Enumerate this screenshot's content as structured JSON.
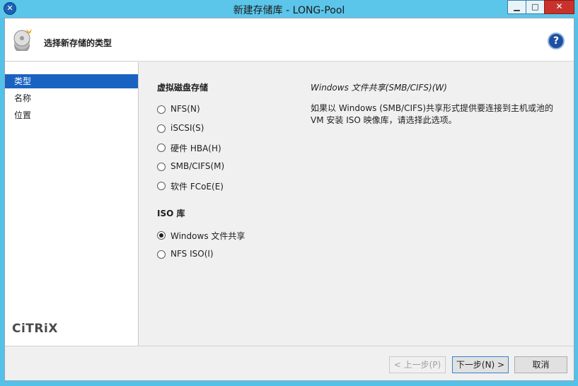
{
  "window": {
    "title": "新建存储库 - LONG-Pool",
    "app_icon": "x-icon",
    "controls": {
      "minimize": "▁",
      "maximize": "□",
      "close": "✕"
    }
  },
  "header": {
    "title": "选择新存储的类型",
    "icon": "disk-icon",
    "help": "?"
  },
  "sidebar": {
    "items": [
      {
        "label": "类型",
        "active": true
      },
      {
        "label": "名称",
        "active": false
      },
      {
        "label": "位置",
        "active": false
      }
    ],
    "logo": "CiTRiX"
  },
  "main": {
    "virtual_disk_section": "虚拟磁盘存储",
    "virtual_disk_options": [
      {
        "label": "NFS(N)",
        "checked": false
      },
      {
        "label": "iSCSI(S)",
        "checked": false
      },
      {
        "label": "硬件 HBA(H)",
        "checked": false
      },
      {
        "label": "SMB/CIFS(M)",
        "checked": false
      },
      {
        "label": "软件 FCoE(E)",
        "checked": false
      }
    ],
    "iso_section": "ISO 库",
    "iso_options": [
      {
        "label": "Windows 文件共享",
        "checked": true
      },
      {
        "label": "NFS ISO(I)",
        "checked": false
      }
    ],
    "description_title": "Windows 文件共享(SMB/CIFS)(W)",
    "description_text": "如果以 Windows (SMB/CIFS)共享形式提供要连接到主机或池的 VM 安装 ISO 映像库，请选择此选项。"
  },
  "footer": {
    "back": "< 上一步(P)",
    "next": "下一步(N) >",
    "cancel": "取消"
  }
}
